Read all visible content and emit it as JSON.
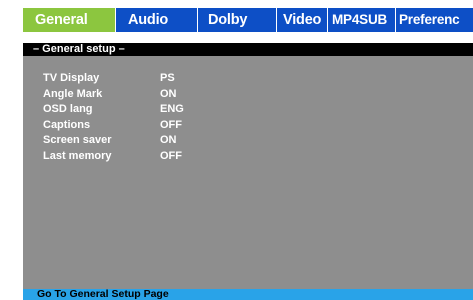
{
  "tabs": [
    {
      "label": "General",
      "active": true
    },
    {
      "label": "Audio",
      "active": false
    },
    {
      "label": "Dolby",
      "active": false
    },
    {
      "label": "Video",
      "active": false
    },
    {
      "label": "MP4SUB",
      "active": false
    },
    {
      "label": "Preferenc",
      "active": false
    }
  ],
  "section": {
    "title": "– General setup –"
  },
  "settings": [
    {
      "label": "TV Display",
      "value": "PS"
    },
    {
      "label": "Angle Mark",
      "value": "ON"
    },
    {
      "label": "OSD lang",
      "value": "ENG"
    },
    {
      "label": "Captions",
      "value": "OFF"
    },
    {
      "label": "Screen saver",
      "value": "ON"
    },
    {
      "label": "Last memory",
      "value": "OFF"
    }
  ],
  "status": {
    "text": "Go To General Setup Page"
  },
  "colors": {
    "tab_bar": "#0d4fc6",
    "active_tab": "#8cc63f",
    "panel": "#8e8e8e",
    "header": "#000000",
    "status_bar": "#29a3e8"
  }
}
